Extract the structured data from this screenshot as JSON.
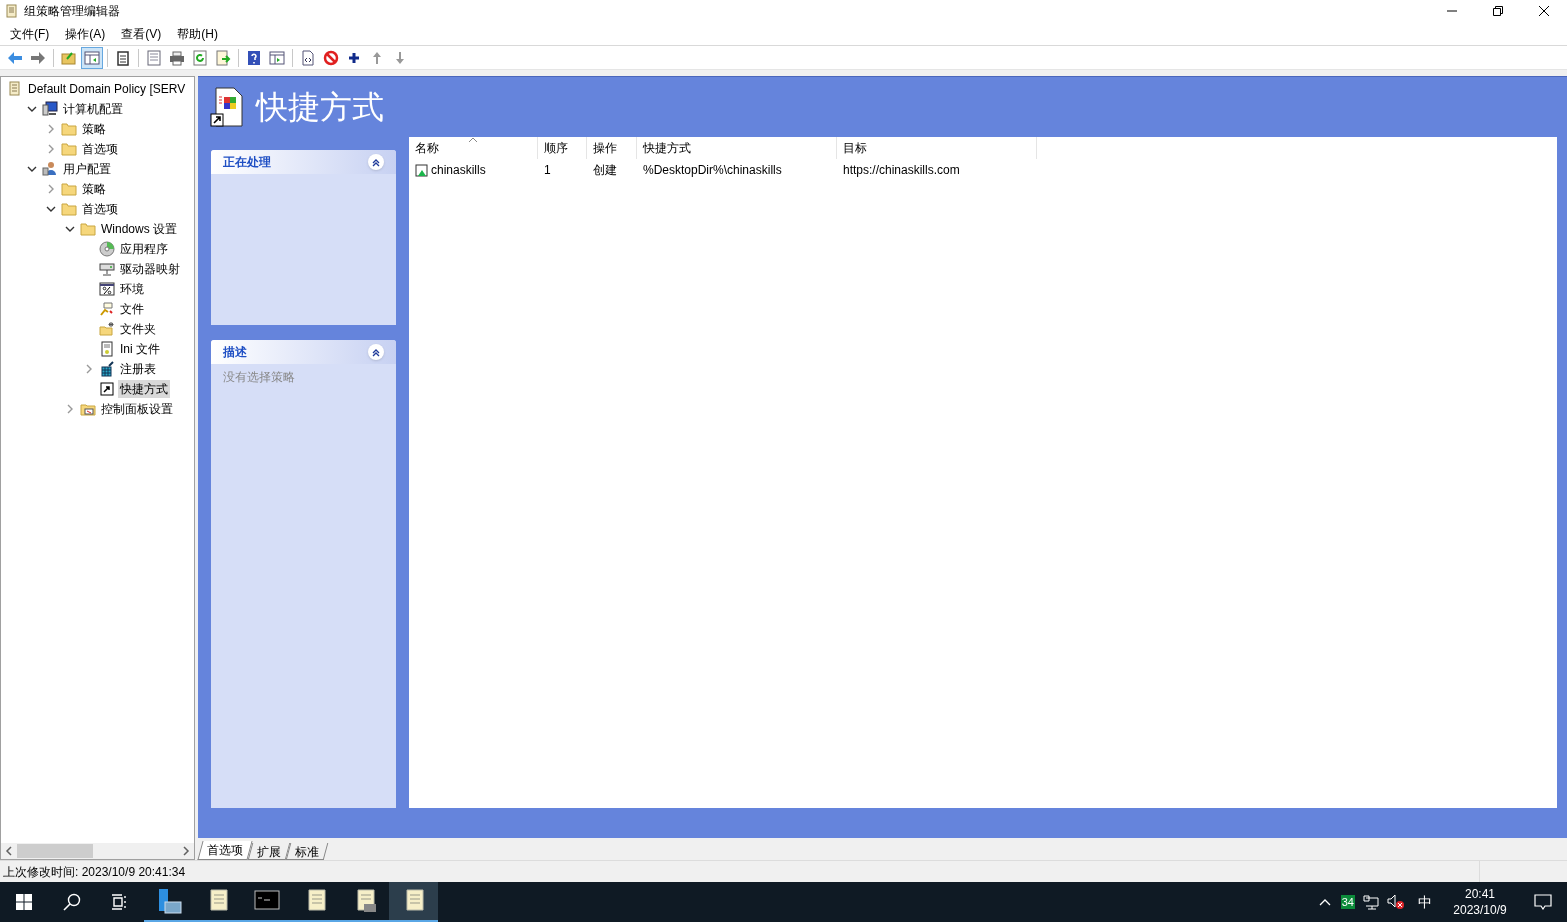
{
  "window": {
    "title": "组策略管理编辑器"
  },
  "menu": [
    "文件(F)",
    "操作(A)",
    "查看(V)",
    "帮助(H)"
  ],
  "toolbar": [
    [
      {
        "kind": "back",
        "pressed": false
      },
      {
        "kind": "forward",
        "pressed": false
      }
    ],
    [
      {
        "kind": "up",
        "pressed": false
      },
      {
        "kind": "tree",
        "pressed": true
      }
    ],
    [
      {
        "kind": "clipboard",
        "pressed": false
      }
    ],
    [
      {
        "kind": "properties",
        "pressed": false
      },
      {
        "kind": "print",
        "pressed": false
      },
      {
        "kind": "refresh",
        "pressed": false
      },
      {
        "kind": "export",
        "pressed": false
      }
    ],
    [
      {
        "kind": "help",
        "pressed": false
      },
      {
        "kind": "pane",
        "pressed": false
      }
    ],
    [
      {
        "kind": "xml",
        "pressed": false
      },
      {
        "kind": "stop",
        "pressed": false
      },
      {
        "kind": "add",
        "pressed": false
      },
      {
        "kind": "moveup",
        "pressed": false
      },
      {
        "kind": "movedown",
        "pressed": false
      }
    ]
  ],
  "tree": [
    {
      "label": "Default Domain Policy [SERV",
      "kind": "policy",
      "selected": false,
      "children": [
        {
          "label": "计算机配置",
          "kind": "computer",
          "expanded": true,
          "selected": false,
          "children": [
            {
              "label": "策略",
              "kind": "folder",
              "expanded": false,
              "selected": false
            },
            {
              "label": "首选项",
              "kind": "folder",
              "expanded": false,
              "selected": false
            }
          ]
        },
        {
          "label": "用户配置",
          "kind": "user",
          "expanded": true,
          "selected": false,
          "children": [
            {
              "label": "策略",
              "kind": "folder",
              "expanded": false,
              "selected": false
            },
            {
              "label": "首选项",
              "kind": "folder",
              "expanded": true,
              "selected": false,
              "children": [
                {
                  "label": "Windows 设置",
                  "kind": "folder",
                  "expanded": true,
                  "selected": false,
                  "children": [
                    {
                      "label": "应用程序",
                      "kind": "disc",
                      "selected": false
                    },
                    {
                      "label": "驱动器映射",
                      "kind": "drive",
                      "selected": false
                    },
                    {
                      "label": "环境",
                      "kind": "env",
                      "selected": false
                    },
                    {
                      "label": "文件",
                      "kind": "file",
                      "selected": false
                    },
                    {
                      "label": "文件夹",
                      "kind": "newfolder",
                      "selected": false
                    },
                    {
                      "label": "Ini 文件",
                      "kind": "ini",
                      "selected": false
                    },
                    {
                      "label": "注册表",
                      "kind": "registry",
                      "expanded": false,
                      "selected": false
                    },
                    {
                      "label": "快捷方式",
                      "kind": "shortcut",
                      "selected": true
                    }
                  ]
                },
                {
                  "label": "控制面板设置",
                  "kind": "cpanel",
                  "expanded": false,
                  "selected": false
                }
              ]
            }
          ]
        }
      ]
    }
  ],
  "header": {
    "title": "快捷方式"
  },
  "task_panels": [
    {
      "title": "正在处理"
    },
    {
      "title": "描述",
      "body": "没有选择策略"
    }
  ],
  "table": {
    "columns": [
      {
        "label": "名称",
        "sorted": true
      },
      {
        "label": "顺序",
        "sorted": false
      },
      {
        "label": "操作",
        "sorted": false
      },
      {
        "label": "快捷方式",
        "sorted": false
      },
      {
        "label": "目标",
        "sorted": false
      }
    ],
    "rows": [
      [
        "chinaskills",
        "1",
        "创建",
        "%DesktopDir%\\chinaskills",
        "https://chinaskills.com"
      ]
    ]
  },
  "bottom_tabs": [
    {
      "label": "首选项",
      "selected": true
    },
    {
      "label": "扩展",
      "selected": false
    },
    {
      "label": "标准",
      "selected": false
    }
  ],
  "status_bar": "上次修改时间: 2023/10/9 20:41:34",
  "taskbar": {
    "apps": [
      {
        "kind": "server",
        "active": false
      },
      {
        "kind": "scroll",
        "active": false
      },
      {
        "kind": "cmd",
        "active": false
      },
      {
        "kind": "scroll",
        "active": false
      },
      {
        "kind": "scrollprint",
        "active": false
      },
      {
        "kind": "scroll",
        "active": true
      }
    ],
    "tray_badge": "34",
    "ime": "中",
    "time": "20:41",
    "date": "2023/10/9"
  }
}
